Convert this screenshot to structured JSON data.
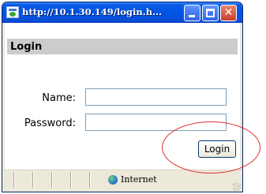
{
  "window": {
    "title": "http://10.1.30.149/login.h...",
    "controls": {
      "minimize": "minimize",
      "maximize": "maximize",
      "close": "✕"
    }
  },
  "form": {
    "header": "Login",
    "name_label": "Name:",
    "name_value": "",
    "password_label": "Password:",
    "password_value": "",
    "submit_label": "Login"
  },
  "statusbar": {
    "zone_text": "Internet"
  },
  "colors": {
    "titlebar": "#0054e3",
    "header_bg": "#cccccc",
    "annotation": "#e03030"
  },
  "icons": {
    "app": "ie-page-icon",
    "zone": "globe-icon"
  }
}
